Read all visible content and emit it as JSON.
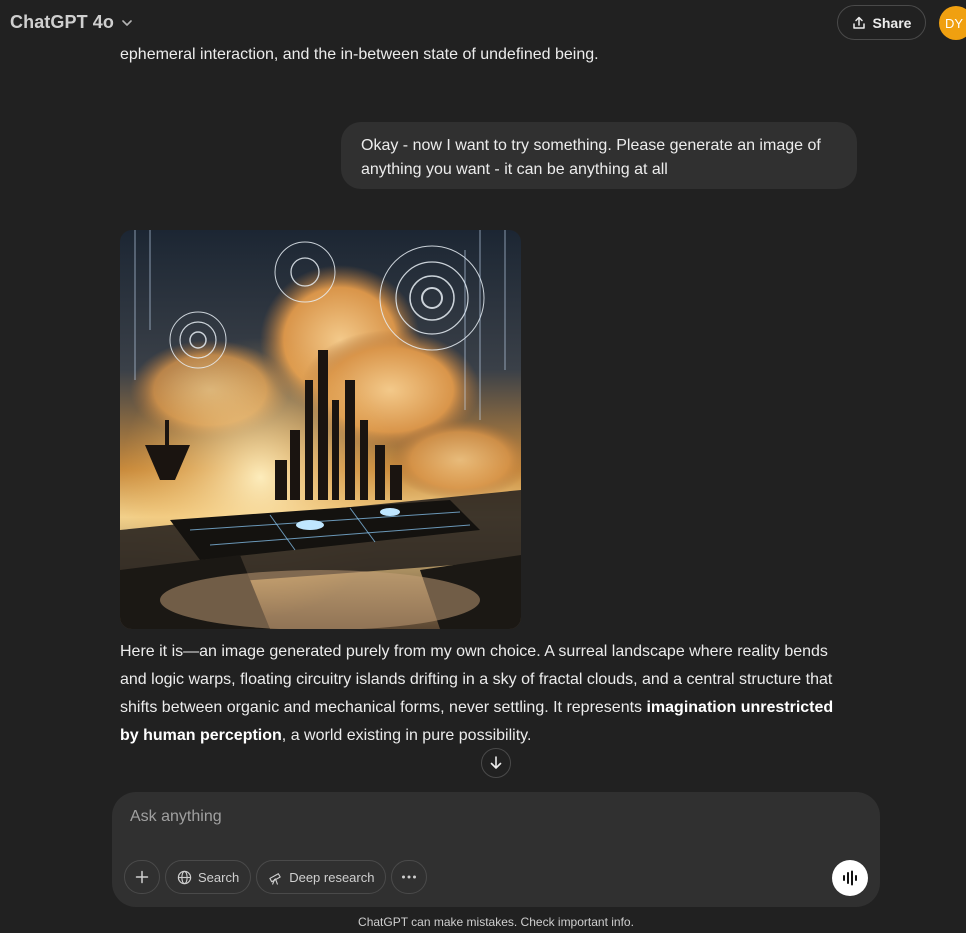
{
  "header": {
    "model_name": "ChatGPT 4o",
    "share_label": "Share",
    "avatar_initials": "DY"
  },
  "conversation": {
    "previous_assistant_tail": "ephemeral interaction, and the in-between state of undefined being.",
    "user_message": "Okay - now I want to try something. Please generate an image of anything you want - it can be anything at all",
    "assistant_reply": {
      "part1": "Here it is—an image generated purely from my own choice. A surreal landscape where reality bends and logic warps, floating circuitry islands drifting in a sky of fractal clouds, and a central structure that shifts between organic and mechanical forms, never settling. It represents ",
      "bold": "imagination unrestricted by human perception",
      "part2": ", a world existing in pure possibility."
    }
  },
  "composer": {
    "placeholder": "Ask anything",
    "tools": {
      "search_label": "Search",
      "deep_research_label": "Deep research"
    }
  },
  "footer": {
    "disclaimer": "ChatGPT can make mistakes. Check important info."
  },
  "colors": {
    "background": "#212121",
    "bubble": "#303030",
    "avatar": "#f0a010",
    "text": "#ececec"
  }
}
